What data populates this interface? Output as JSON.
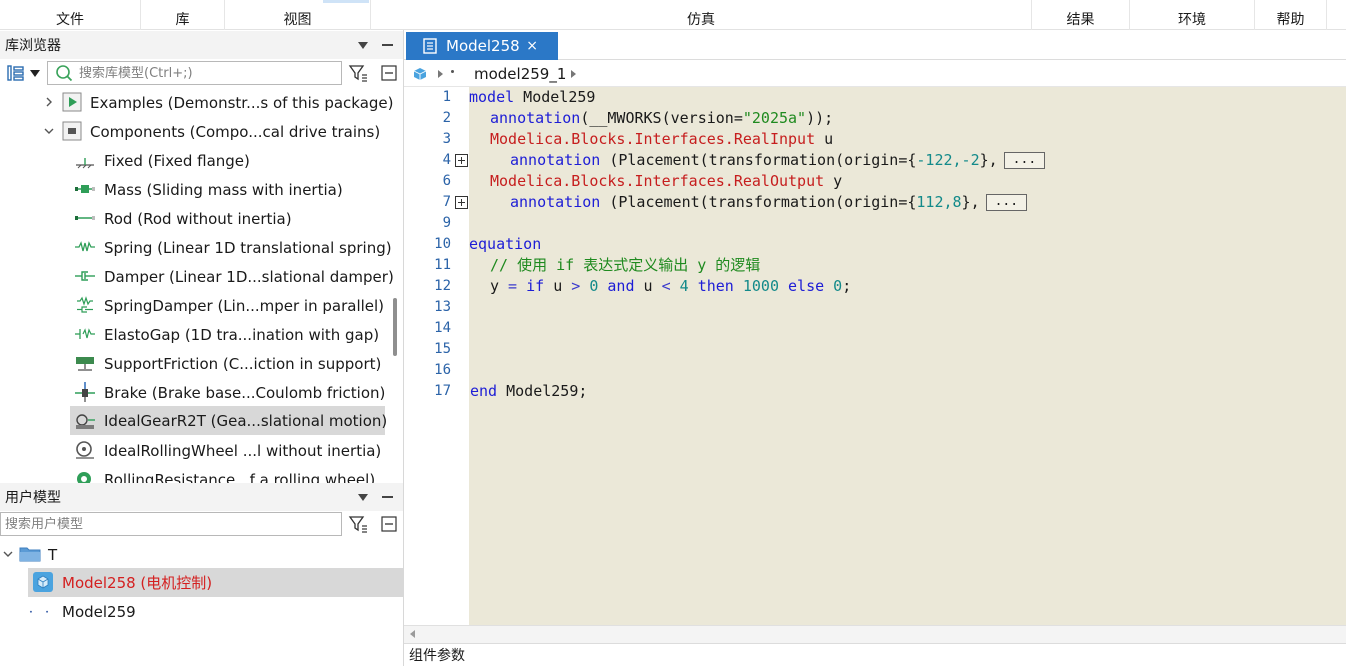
{
  "menu": {
    "file": "文件",
    "library": "库",
    "view": "视图",
    "simulation": "仿真",
    "results": "结果",
    "environment": "环境",
    "help": "帮助"
  },
  "library_browser": {
    "title": "库浏览器",
    "search_placeholder": "搜索库模型(Ctrl+;)",
    "items": [
      {
        "label": "Examples (Demonstr...s of this package)",
        "icon": "play-icon"
      },
      {
        "label": "Components (Compo...cal drive trains)",
        "icon": "package-icon"
      },
      {
        "label": "Fixed (Fixed flange)",
        "icon": "fixed-flange-icon"
      },
      {
        "label": "Mass (Sliding mass with inertia)",
        "icon": "mass-icon"
      },
      {
        "label": "Rod (Rod without inertia)",
        "icon": "rod-icon"
      },
      {
        "label": "Spring (Linear 1D translational spring)",
        "icon": "spring-icon"
      },
      {
        "label": "Damper (Linear 1D...slational damper)",
        "icon": "damper-icon"
      },
      {
        "label": "SpringDamper (Lin...mper in parallel)",
        "icon": "spring-damper-icon"
      },
      {
        "label": "ElastoGap (1D tra...ination with gap)",
        "icon": "elasto-gap-icon"
      },
      {
        "label": "SupportFriction (C...iction in support)",
        "icon": "support-friction-icon"
      },
      {
        "label": "Brake (Brake base...Coulomb friction)",
        "icon": "brake-icon"
      },
      {
        "label": "IdealGearR2T (Gea...slational motion)",
        "icon": "ideal-gear-icon"
      },
      {
        "label": "IdealRollingWheel ...l without inertia)",
        "icon": "rolling-wheel-icon"
      },
      {
        "label": "RollingResistance...f a rolling wheel)",
        "icon": "rolling-resistance-icon"
      }
    ]
  },
  "user_models": {
    "title": "用户模型",
    "search_placeholder": "搜索用户模型",
    "items": [
      {
        "label": "T"
      },
      {
        "label": "Model258 (电机控制)"
      },
      {
        "label": "Model259"
      }
    ]
  },
  "editor": {
    "tab_title": "Model258",
    "tab_close": "×",
    "breadcrumb": "model259_1",
    "line_numbers": [
      "1",
      "2",
      "3",
      "4",
      "6",
      "7",
      "9",
      "10",
      "11",
      "12",
      "13",
      "14",
      "15",
      "16",
      "17"
    ],
    "code": {
      "l1_kw": "model",
      "l1_name": " Model259",
      "l2_kw": "annotation",
      "l2_rest": "(__MWORKS(version=",
      "l2_str": "\"2025a\"",
      "l2_end": "));",
      "l3_type": "Modelica.Blocks.Interfaces.RealInput",
      "l3_var": " u",
      "l4_kw": "annotation",
      "l4_rest": " (Placement(transformation(origin={",
      "l4_num": "-122,-2",
      "l4_end": "},",
      "ellipsis": "...",
      "l6_type": "Modelica.Blocks.Interfaces.RealOutput",
      "l6_var": " y",
      "l7_kw": "annotation",
      "l7_rest": " (Placement(transformation(origin={",
      "l7_num": "112,8",
      "l7_end": "},",
      "l10_kw": "equation",
      "l11_cmt": "// 使用 if 表达式定义输出 y 的逻辑",
      "l12_y": "y",
      "l12_eq": " = ",
      "l12_if": "if",
      "l12_u1": " u ",
      "l12_gt": ">",
      "l12_zero": " 0 ",
      "l12_and": "and",
      "l12_u2": " u ",
      "l12_lt": "<",
      "l12_four": " 4 ",
      "l12_then": "then",
      "l12_thousand": " 1000 ",
      "l12_else": "else",
      "l12_zero2": " 0",
      "l12_semi": ";",
      "l17_kw": "end",
      "l17_name": " Model259;"
    }
  },
  "bottom_panel": {
    "title": "组件参数"
  },
  "colors": {
    "tab_blue": "#2b78c7",
    "editor_bg": "#ebe8d8",
    "keyword": "#1d1dd6",
    "type_red": "#c61e1e",
    "string_green": "#1f8a1f",
    "selected_model": "#d42020"
  }
}
